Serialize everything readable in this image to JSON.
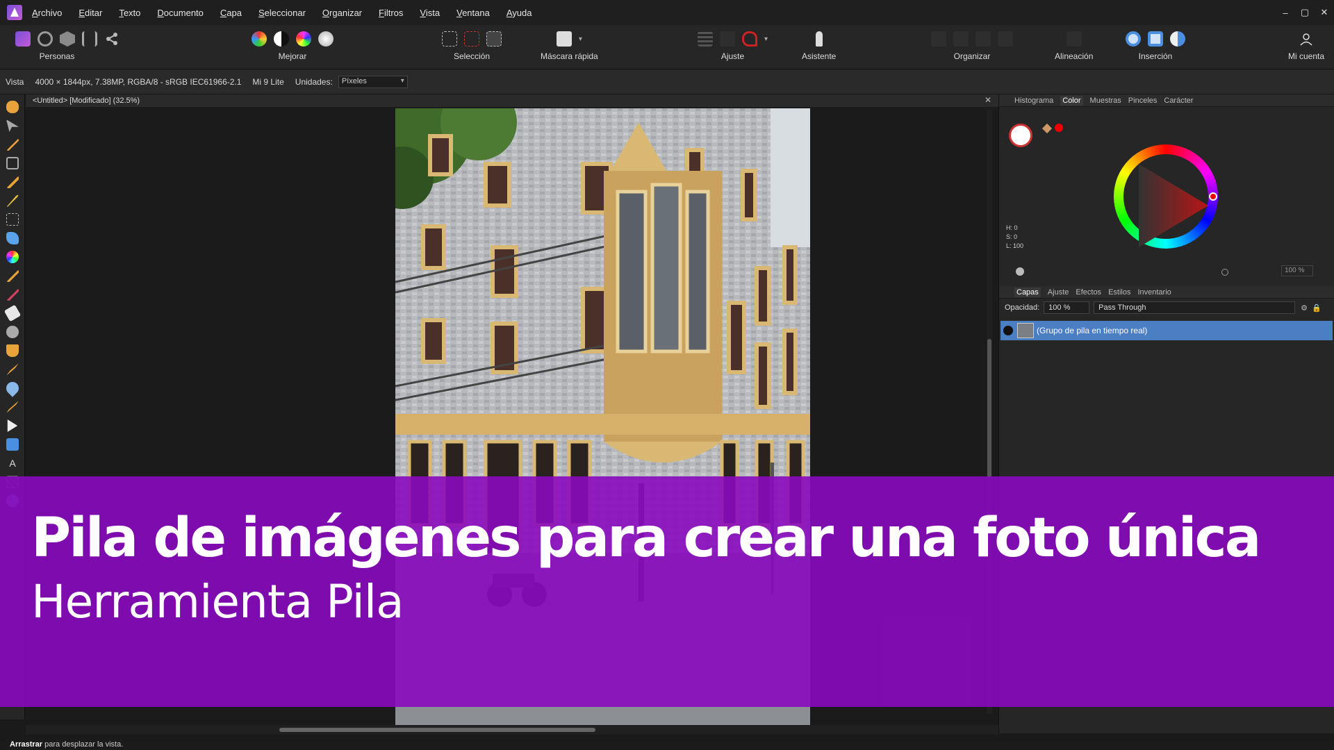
{
  "menu": {
    "items": [
      "Archivo",
      "Editar",
      "Texto",
      "Documento",
      "Capa",
      "Seleccionar",
      "Organizar",
      "Filtros",
      "Vista",
      "Ventana",
      "Ayuda"
    ]
  },
  "window_controls": {
    "minimize": "–",
    "maximize": "▢",
    "close": "✕"
  },
  "toolbar": {
    "personas": "Personas",
    "mejorar": "Mejorar",
    "seleccion": "Selección",
    "mascara": "Máscara rápida",
    "ajuste": "Ajuste",
    "asistente": "Asistente",
    "organizar": "Organizar",
    "alineacion": "Alineación",
    "insercion": "Inserción",
    "cuenta": "Mi cuenta"
  },
  "context": {
    "vista": "Vista",
    "doc_info": "4000 × 1844px, 7.38MP, RGBA/8 - sRGB IEC61966-2.1",
    "camera": "Mi 9 Lite",
    "units_label": "Unidades:",
    "units_value": "Píxeles"
  },
  "document": {
    "tab_title": "<Untitled> [Modificado] (32.5%)",
    "close": "✕"
  },
  "color_panel": {
    "tabs": [
      "Histograma",
      "Color",
      "Muestras",
      "Pinceles",
      "Carácter"
    ],
    "h": "H: 0",
    "s": "S: 0",
    "l": "L: 100",
    "opacity": "100 %"
  },
  "layers_panel": {
    "tabs": [
      "Capas",
      "Ajuste",
      "Efectos",
      "Estilos",
      "Inventario"
    ],
    "opacity_label": "Opacidad:",
    "opacity_value": "100 %",
    "blend_mode": "Pass Through",
    "layer_name": "(Grupo de pila en tiempo real)"
  },
  "banner": {
    "title": "Pila de imágenes para crear una foto única",
    "subtitle": "Herramienta Pila"
  },
  "status": {
    "bold": "Arrastrar",
    "rest": "para desplazar la vista."
  },
  "colors": {
    "accent": "#8a0abe",
    "selection": "#4b7fc4",
    "bg": "#1a1a1a"
  }
}
